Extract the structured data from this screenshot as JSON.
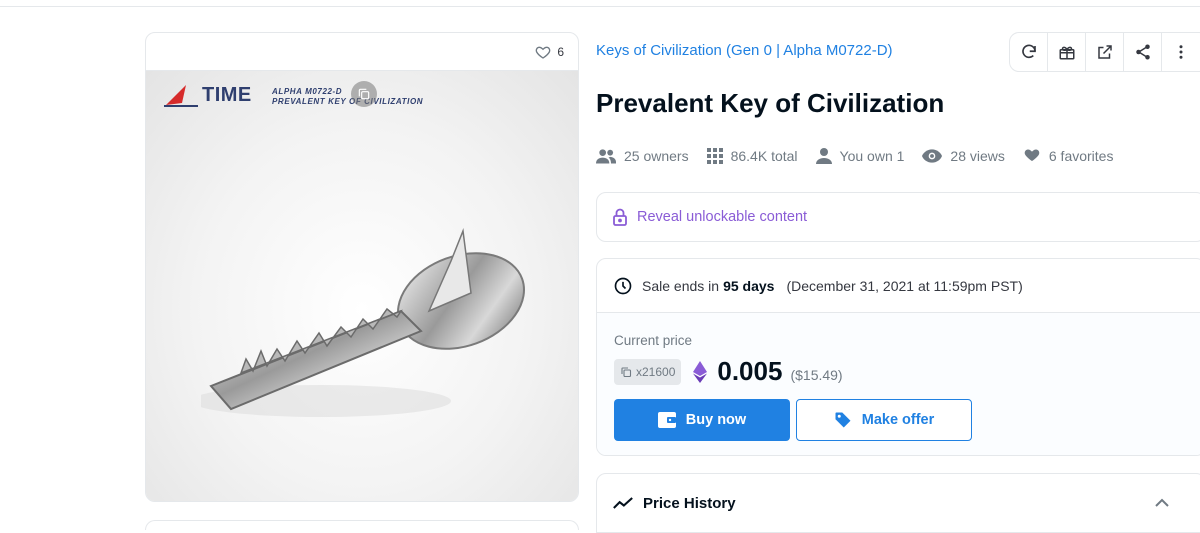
{
  "item": {
    "favorites_count": "6",
    "collection": "Keys of Civilization (Gen 0 | Alpha M0722-D)",
    "title": "Prevalent Key of Civilization"
  },
  "artwork": {
    "brand": "TIME",
    "subtitle_line1": "ALPHA M0722-D",
    "subtitle_line2": "PREVALENT KEY OF CIVILIZATION"
  },
  "stats": {
    "owners": "25 owners",
    "total": "86.4K total",
    "you_own": "You own 1",
    "views": "28 views",
    "favorites": "6 favorites"
  },
  "unlockable": {
    "label": "Reveal unlockable content"
  },
  "sale": {
    "ends_prefix": "Sale ends in",
    "ends_days": "95 days",
    "ends_date": "(December 31, 2021 at 11:59pm PST)",
    "current_price_label": "Current price",
    "quantity": "x21600",
    "price_eth": "0.005",
    "price_usd": "($15.49)",
    "buy_label": "Buy now",
    "offer_label": "Make offer"
  },
  "price_history": {
    "label": "Price History"
  },
  "colors": {
    "accent": "#2081e2",
    "unlock": "#8a5cd6",
    "text_muted": "#707a83",
    "border": "#e5e8eb"
  },
  "icons": {
    "refresh": "refresh-icon",
    "transfer": "gift-icon",
    "external": "external-link-icon",
    "share": "share-icon",
    "more": "more-vertical-icon"
  }
}
